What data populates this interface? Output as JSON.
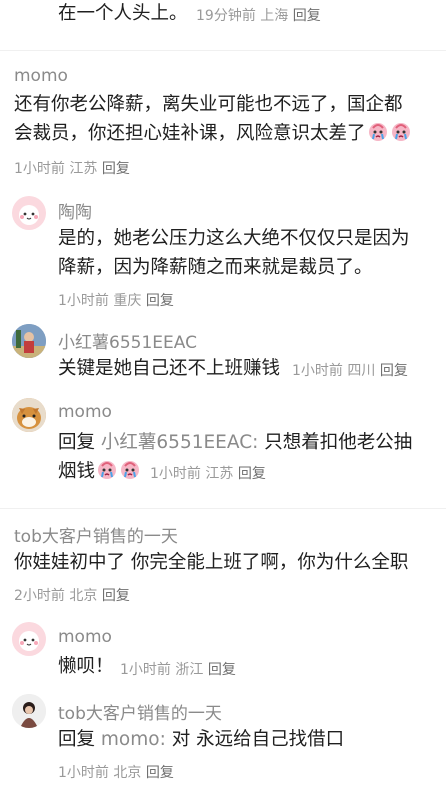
{
  "top": {
    "text": "在一个人头上。",
    "time": "19分钟前",
    "location": "上海",
    "reply": "回复"
  },
  "comments": [
    {
      "name": "momo",
      "text_line1": "还有你老公降薪，离失业可能也不远了，国企都",
      "text_line2": "会裁员，你还担心娃补课，风险意识太差了",
      "time": "1小时前",
      "location": "江苏",
      "reply": "回复"
    },
    {
      "name": "陶陶",
      "text_line1": "是的，她老公压力这么大绝不仅仅只是因为",
      "text_line2": "降薪，因为降薪随之而来就是裁员了。",
      "time": "1小时前",
      "location": "重庆",
      "reply": "回复"
    },
    {
      "name": "小红薯6551EEAC",
      "text": "关键是她自己还不上班赚钱",
      "time": "1小时前",
      "location": "四川",
      "reply": "回复"
    },
    {
      "name": "momo",
      "reply_prefix": "回复",
      "reply_target": "小红薯6551EEAC:",
      "text_line1": "只想着扣他老公抽",
      "text_line2": "烟钱",
      "time": "1小时前",
      "location": "江苏",
      "reply": "回复"
    },
    {
      "name": "tob大客户销售的一天",
      "text": "你娃娃初中了 你完全能上班了啊，你为什么全职",
      "time": "2小时前",
      "location": "北京",
      "reply": "回复"
    },
    {
      "name": "momo",
      "text": "懒呗！",
      "time": "1小时前",
      "location": "浙江",
      "reply": "回复"
    },
    {
      "name": "tob大客户销售的一天",
      "reply_prefix": "回复",
      "reply_target": "momo:",
      "text": "对 永远给自己找借口",
      "time": "1小时前",
      "location": "北京",
      "reply": "回复"
    }
  ],
  "icons": {
    "emoji": "crying-face-emoji"
  },
  "colors": {
    "name": "#8a8a8a",
    "text": "#1f1f1f",
    "meta": "#9a9a9a"
  }
}
